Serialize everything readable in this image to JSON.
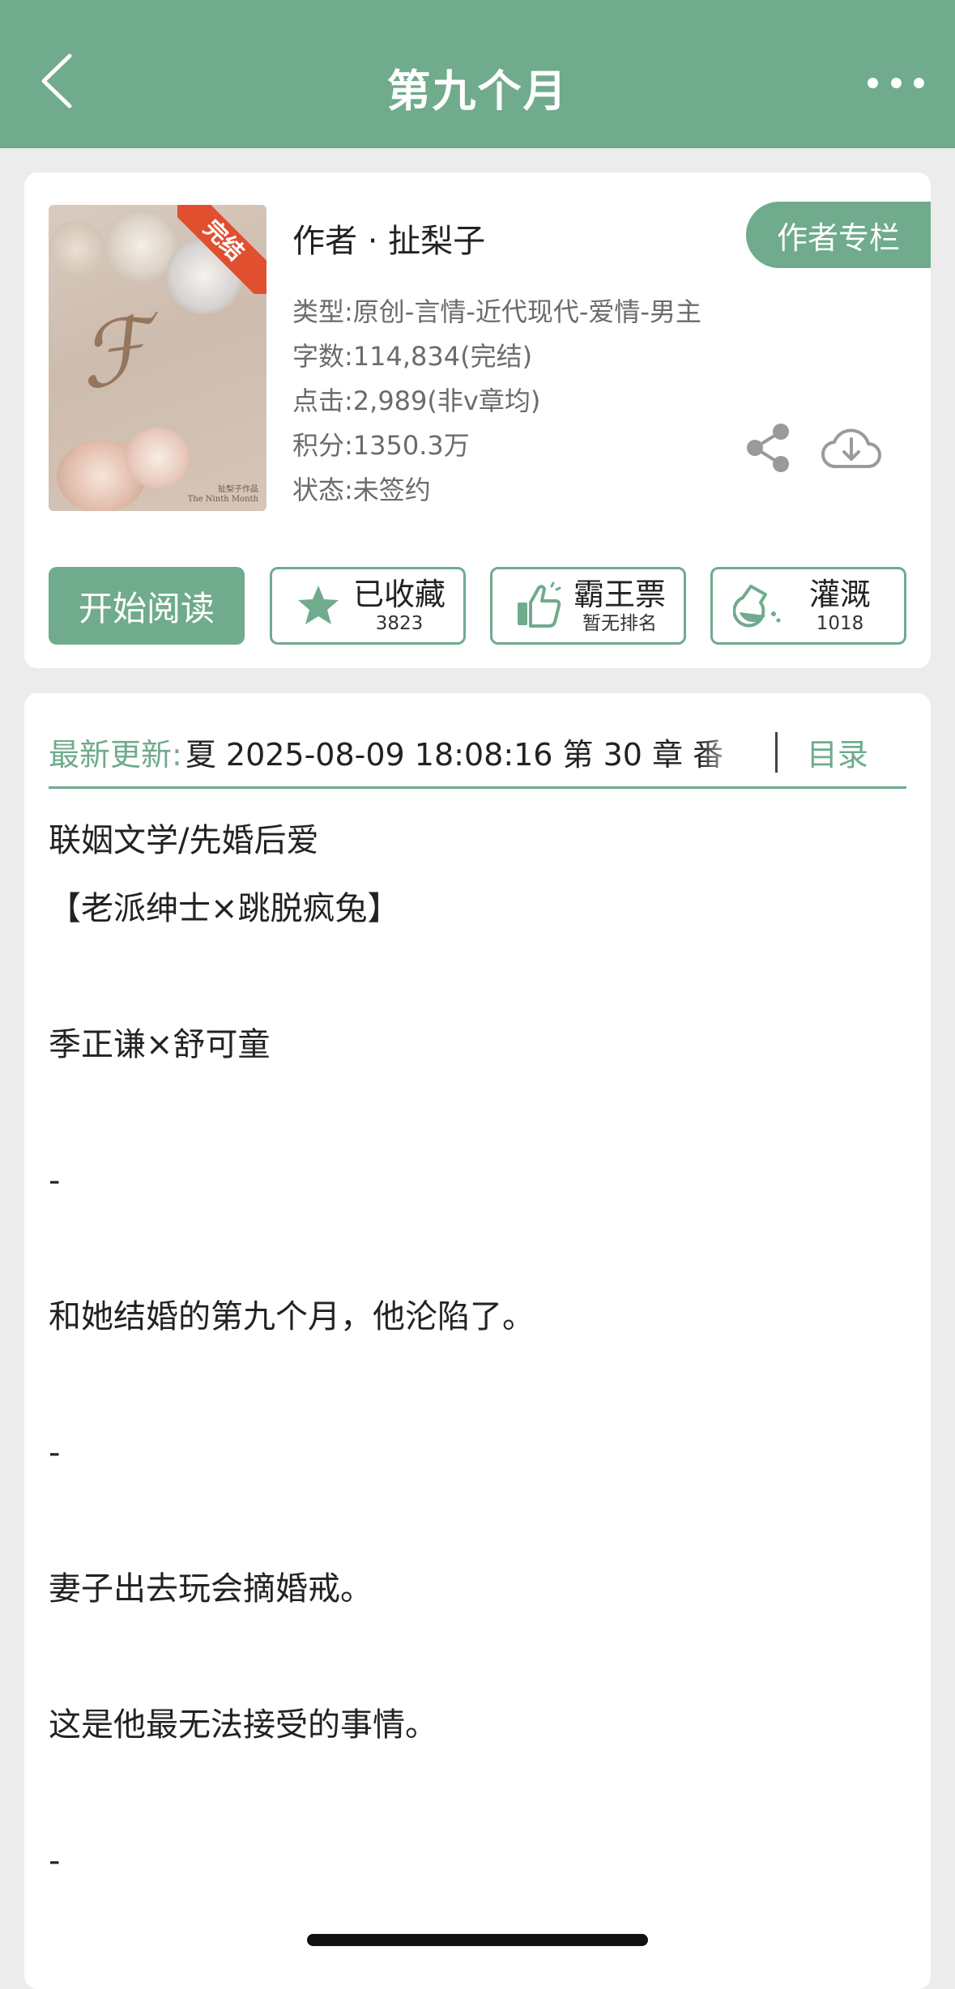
{
  "header": {
    "title": "第九个月",
    "back_icon": "chevron-left-icon",
    "more_icon": "more-horizontal-icon"
  },
  "book": {
    "cover_badge": "完结",
    "cover_subtitle_1": "扯梨子作品",
    "cover_subtitle_2": "The Ninth Month",
    "author_line": "作者 · 扯梨子",
    "author_column_label": "作者专栏",
    "meta": [
      "类型:原创-言情-近代现代-爱情-男主",
      "字数:114,834(完结)",
      "点击:2,989(非v章均)",
      "积分:1350.3万",
      "状态:未签约"
    ]
  },
  "actions": {
    "read_label": "开始阅读",
    "collect_label": "已收藏",
    "collect_count": "3823",
    "ticket_label": "霸王票",
    "ticket_sub": "暂无排名",
    "nutrient_label": "灌溉",
    "nutrient_count": "1018"
  },
  "update": {
    "label": "最新更新:",
    "text": "夏 2025-08-09 18:08:16   第 30 章  番",
    "toc_label": "目录"
  },
  "synopsis": [
    "联姻文学/先婚后爱",
    "【老派绅士×跳脱疯兔】",
    "",
    "季正谦×舒可童",
    "",
    "-",
    "",
    "和她结婚的第九个月，他沦陷了。",
    "",
    "-",
    "",
    "妻子出去玩会摘婚戒。",
    "",
    "这是他最无法接受的事情。",
    "",
    "-"
  ],
  "colors": {
    "brand": "#6fab8c",
    "badge": "#e0502f"
  }
}
